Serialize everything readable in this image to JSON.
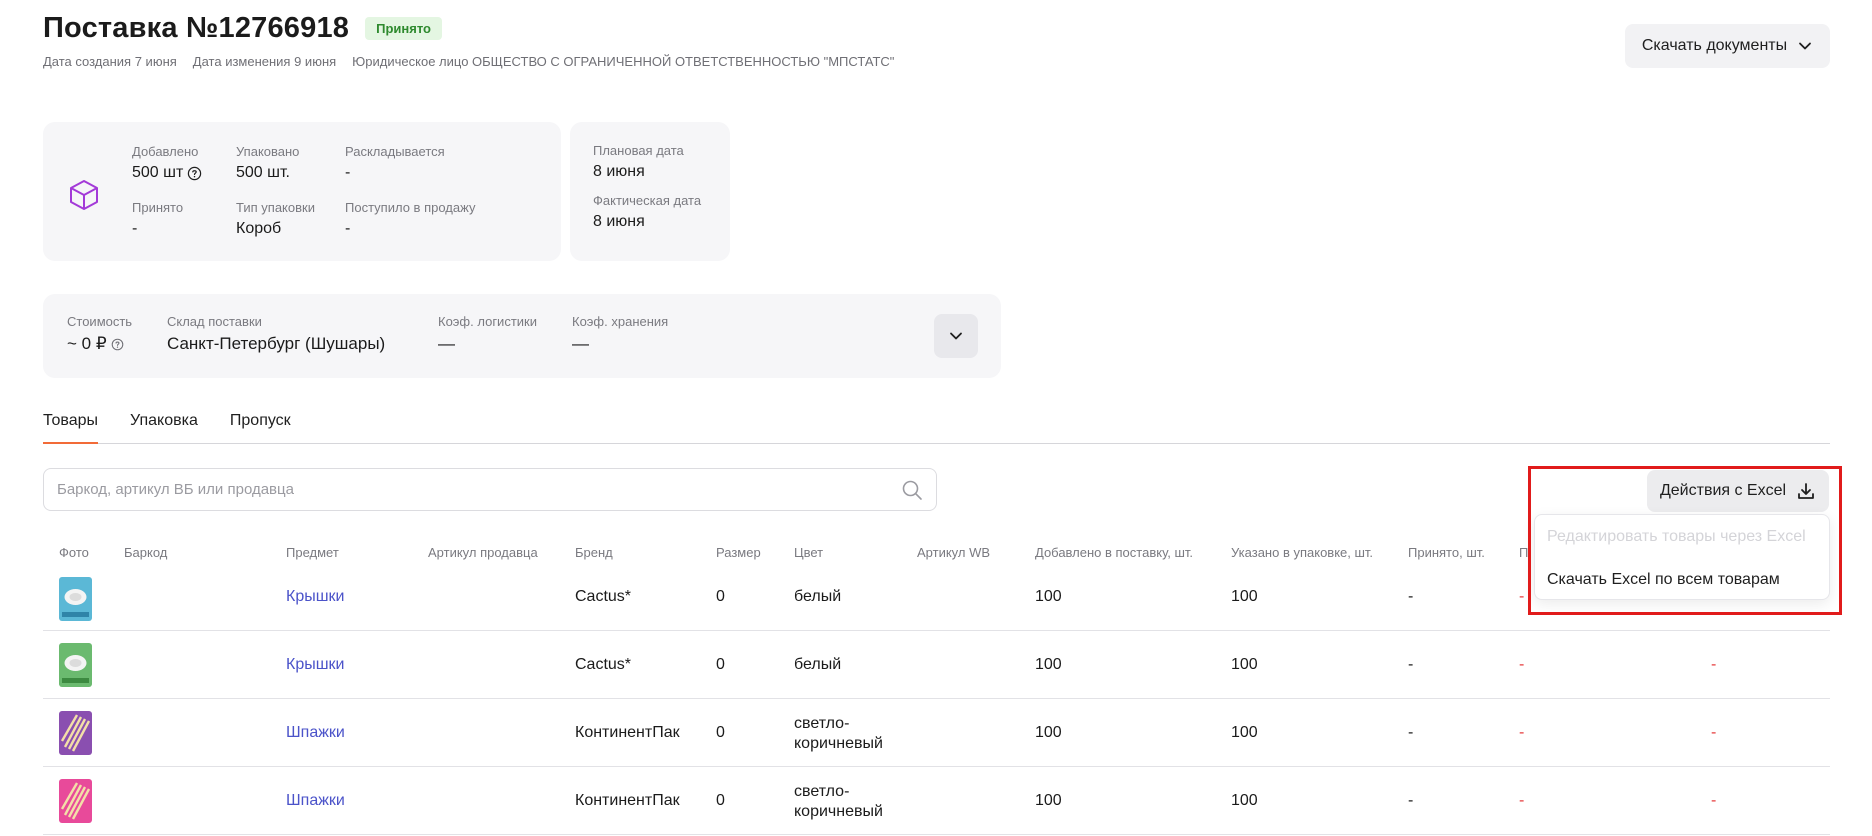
{
  "header": {
    "title": "Поставка №12766918",
    "status": "Принято",
    "created": "Дата создания 7 июня",
    "modified": "Дата изменения 9 июня",
    "entity": "Юридическое лицо ОБЩЕСТВО С ОГРАНИЧЕННОЙ ОТВЕТСТВЕННОСТЬЮ \"МПСТАТС\"",
    "download_docs_label": "Скачать документы"
  },
  "summary": {
    "added_label": "Добавлено",
    "added_value": "500 шт",
    "packed_label": "Упаковано",
    "packed_value": "500 шт.",
    "sorting_label": "Раскладывается",
    "sorting_value": "-",
    "accepted_label": "Принято",
    "accepted_value": "-",
    "pack_type_label": "Тип упаковки",
    "pack_type_value": "Короб",
    "on_sale_label": "Поступило в продажу",
    "on_sale_value": "-"
  },
  "dates": {
    "planned_label": "Плановая дата",
    "planned_value": "8 июня",
    "actual_label": "Фактическая дата",
    "actual_value": "8 июня"
  },
  "costs": {
    "cost_label": "Стоимость",
    "cost_value": "~ 0 ₽",
    "warehouse_label": "Склад поставки",
    "warehouse_value": "Санкт-Петербург (Шушары)",
    "logistics_label": "Коэф. логистики",
    "logistics_value": "—",
    "storage_label": "Коэф. хранения",
    "storage_value": "—"
  },
  "tabs": [
    {
      "label": "Товары",
      "active": true
    },
    {
      "label": "Упаковка",
      "active": false
    },
    {
      "label": "Пропуск",
      "active": false
    }
  ],
  "search": {
    "placeholder": "Баркод, артикул ВБ или продавца"
  },
  "excel": {
    "button_label": "Действия с Excel",
    "menu": [
      {
        "label": "Редактировать товары через Excel",
        "disabled": true
      },
      {
        "label": "Скачать Excel по всем товарам",
        "disabled": false
      }
    ]
  },
  "table": {
    "columns": {
      "photo": "Фото",
      "barcode": "Баркод",
      "subject": "Предмет",
      "seller_article": "Артикул продавца",
      "brand": "Бренд",
      "size": "Размер",
      "color": "Цвет",
      "wb_article": "Артикул WB",
      "added": "Добавлено в поставку, шт.",
      "in_pack": "Указано в упаковке, шт.",
      "accepted": "Принято, шт.",
      "extra": "П"
    },
    "rows": [
      {
        "thumb": "#5bb8d6",
        "subject": "Крышки",
        "brand": "Cactus*",
        "size": "0",
        "color": "белый",
        "added": "100",
        "in_pack": "100",
        "accepted": "-",
        "extra1": "-",
        "extra2": ""
      },
      {
        "thumb": "#6bba6f",
        "subject": "Крышки",
        "brand": "Cactus*",
        "size": "0",
        "color": "белый",
        "added": "100",
        "in_pack": "100",
        "accepted": "-",
        "extra1": "-",
        "extra2": "-"
      },
      {
        "thumb": "#8a4fb0",
        "subject": "Шпажки",
        "brand": "КонтинентПак",
        "size": "0",
        "color": "светло-коричневый",
        "added": "100",
        "in_pack": "100",
        "accepted": "-",
        "extra1": "-",
        "extra2": "-"
      },
      {
        "thumb": "#e84a9a",
        "subject": "Шпажки",
        "brand": "КонтинентПак",
        "size": "0",
        "color": "светло-коричневый",
        "added": "100",
        "in_pack": "100",
        "accepted": "-",
        "extra1": "-",
        "extra2": "-"
      }
    ]
  },
  "colors": {
    "accent": "#f26b38",
    "link": "#4b53c9",
    "status_bg": "#e4f6e2",
    "status_text": "#2e8a2e",
    "highlight": "#e11b1b",
    "dash_red": "#e6393a"
  }
}
